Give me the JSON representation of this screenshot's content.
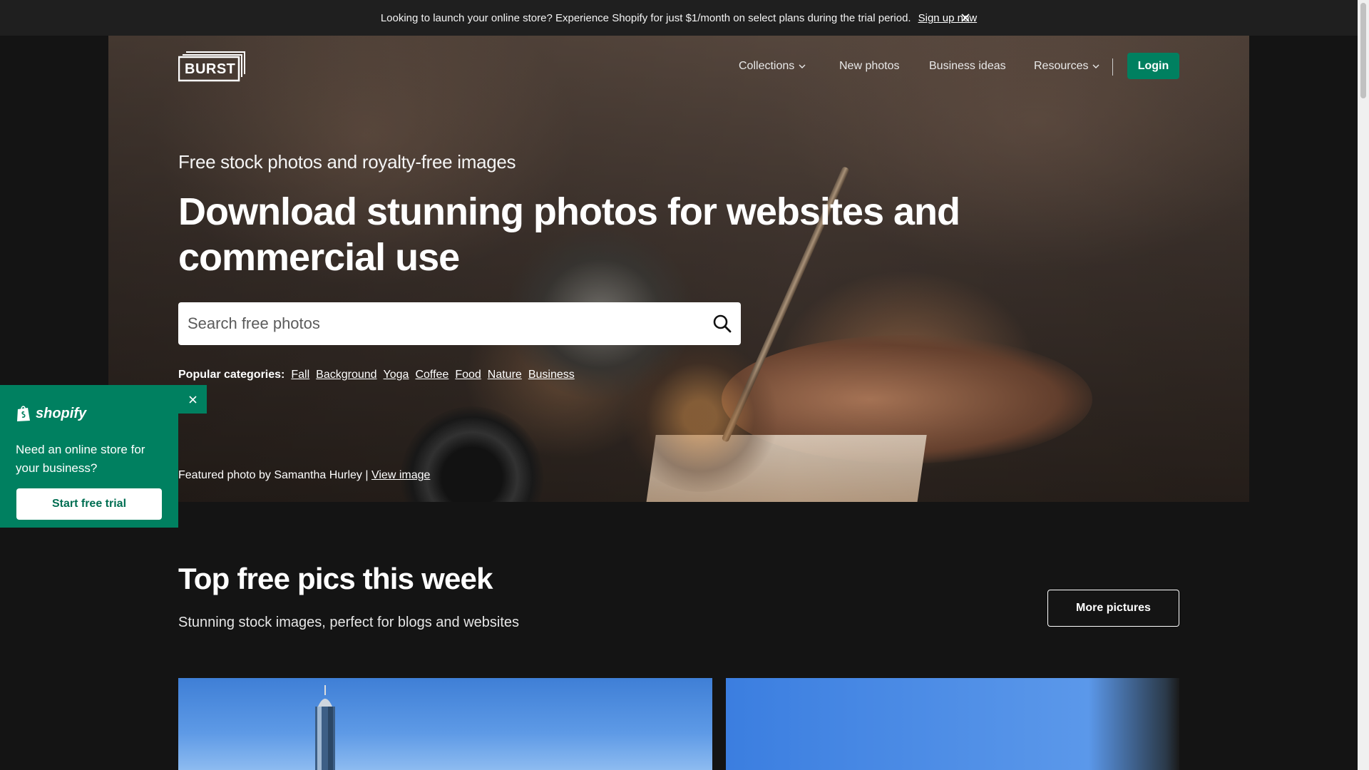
{
  "announcement": {
    "text": "Looking to launch your online store? Experience Shopify for just $1/month on select plans during the trial period.",
    "link": "Sign up now"
  },
  "header": {
    "logo_text": "BURST",
    "nav": [
      {
        "label": "Collections",
        "dropdown": true
      },
      {
        "label": "New photos",
        "dropdown": false
      },
      {
        "label": "Business ideas",
        "dropdown": false
      },
      {
        "label": "Resources",
        "dropdown": true
      }
    ],
    "login_label": "Login",
    "login_color": "#008060"
  },
  "hero": {
    "eyebrow": "Free stock photos and royalty-free images",
    "headline": "Download stunning photos for websites and commercial use",
    "search_placeholder": "Search free photos",
    "categories_label": "Popular categories:",
    "categories": [
      "Fall",
      "Background",
      "Yoga",
      "Coffee",
      "Food",
      "Nature",
      "Business"
    ],
    "credit_text": "Featured photo by Samantha Hurley |",
    "credit_link": "View image"
  },
  "promo": {
    "brand": "shopify",
    "message": "Need an online store for your business?",
    "cta": "Start free trial",
    "background": "#008060"
  },
  "section": {
    "title": "Top free pics this week",
    "subtitle": "Stunning stock images, perfect for blogs and websites",
    "more_label": "More pictures"
  }
}
